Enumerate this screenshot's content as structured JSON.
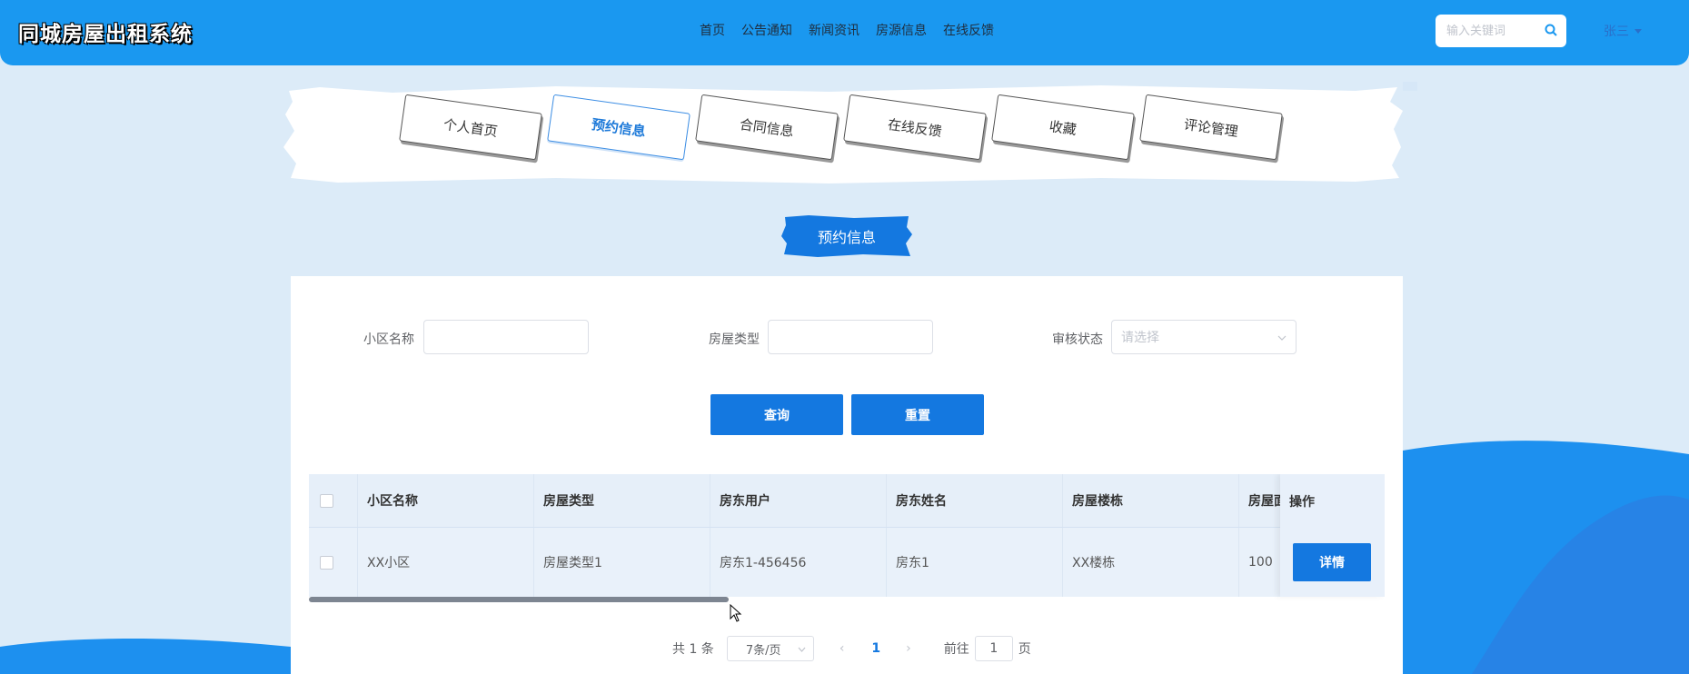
{
  "header": {
    "brand": "同城房屋出租系统",
    "nav": [
      "首页",
      "公告通知",
      "新闻资讯",
      "房源信息",
      "在线反馈"
    ],
    "search_placeholder": "输入关键词",
    "user": "张三"
  },
  "tabs": [
    "个人首页",
    "预约信息",
    "合同信息",
    "在线反馈",
    "收藏",
    "评论管理"
  ],
  "active_tab": "预约信息",
  "section_title": "预约信息",
  "filters": {
    "community_label": "小区名称",
    "community_value": "",
    "house_type_label": "房屋类型",
    "house_type_value": "",
    "status_label": "审核状态",
    "status_placeholder": "请选择"
  },
  "buttons": {
    "search": "查询",
    "reset": "重置"
  },
  "table": {
    "headers": [
      "小区名称",
      "房屋类型",
      "房东用户",
      "房东姓名",
      "房屋楼栋",
      "房屋面"
    ],
    "op_header": "操作",
    "rows": [
      {
        "cells": [
          "XX小区",
          "房屋类型1",
          "房东1-456456",
          "房东1",
          "XX楼栋",
          "100"
        ],
        "action": "详情"
      }
    ]
  },
  "pagination": {
    "total": "共 1 条",
    "page_size": "7条/页",
    "current_page": "1",
    "goto_label": "前往",
    "goto_value": "1",
    "page_suffix": "页"
  },
  "colors": {
    "primary": "#1478e0",
    "header": "#1a98f0",
    "background": "#dcebf8"
  },
  "scroll": {
    "horizontal_fraction": 0.39
  }
}
